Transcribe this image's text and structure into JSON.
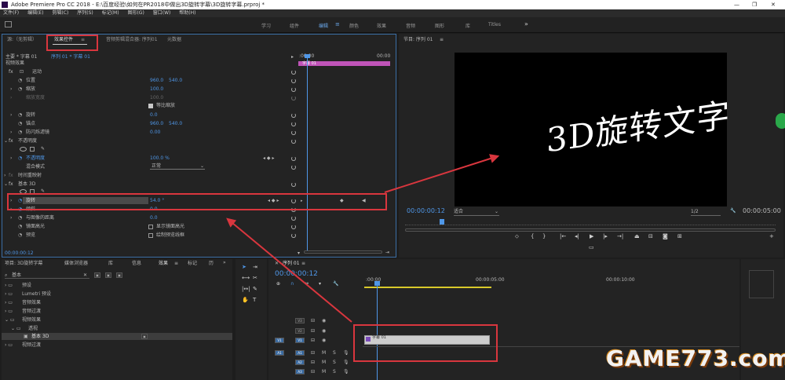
{
  "titlebar": {
    "title": "Adobe Premiere Pro CC 2018 - E:\\百度经验\\如何在PR2018中做出3D旋转字幕\\3D旋转字幕.prproj *"
  },
  "menu": [
    "文件(F)",
    "编辑(E)",
    "剪辑(C)",
    "序列(S)",
    "标记(M)",
    "图形(G)",
    "窗口(W)",
    "帮助(H)"
  ],
  "workspaces": [
    "学习",
    "组件",
    "编辑",
    "颜色",
    "效果",
    "音频",
    "图形",
    "库",
    "Titles"
  ],
  "effect_controls": {
    "tabs": [
      "源:（无剪辑）",
      "效果控件",
      "音频剪辑混合器: 序列01",
      "元数据"
    ],
    "header_master": "主要 * 字幕 01",
    "header_seq": "序列 01 * 字幕 01",
    "ruler_start": ":00:00",
    "ruler_end": "00:00",
    "clip_label": "字幕 01",
    "video_effects": "视频效果",
    "motion": "运动",
    "position": "位置",
    "position_x": "960.0",
    "position_y": "540.0",
    "scale": "缩放",
    "scale_val": "100.0",
    "scale_width": "缩放宽度",
    "scale_width_val": "100.0",
    "uniform_scale": "等比缩放",
    "rotation": "旋转",
    "rotation_val": "0.0",
    "anchor": "锚点",
    "anchor_x": "960.0",
    "anchor_y": "540.0",
    "antiflicker": "防闪烁滤镜",
    "antiflicker_val": "0.00",
    "opacity_group": "不透明度",
    "opacity": "不透明度",
    "opacity_val": "100.0 %",
    "blend": "混合模式",
    "blend_val": "正常",
    "time_remap": "时间重映射",
    "basic3d": "基本 3D",
    "swivel": "旋转",
    "swivel_val": "54.0 °",
    "tilt": "倾斜",
    "tilt_val": "0.0",
    "distance": "与图像的距离",
    "distance_val": "0.0",
    "specular": "镜面高光",
    "specular_opt": "显示镜面高光",
    "preview": "预览",
    "preview_opt": "绘制预览线框",
    "timecode": "00:00:00:12"
  },
  "program": {
    "title": "节目: 序列 01",
    "overlay_text": "3D旋转文字",
    "timecode": "00:00:00:12",
    "fit": "适合",
    "quality": "1/2",
    "duration": "00:00:05:00"
  },
  "project": {
    "tabs": [
      "项目: 3D旋转字幕",
      "媒体浏览器",
      "库",
      "信息",
      "效果",
      "标记",
      "历"
    ],
    "search": "基本",
    "tree": [
      "预设",
      "Lumetri 预设",
      "音频效果",
      "音频过渡",
      "视频效果",
      "透视",
      "基本 3D",
      "视频过渡"
    ]
  },
  "timeline": {
    "tab": "序列 01",
    "timecode": "00:00:00:12",
    "ruler": [
      ":00:00",
      "00:00:05:00",
      "00:00:10:00"
    ],
    "video_tracks": [
      "V3",
      "V2",
      "V1"
    ],
    "audio_tracks": [
      "A1",
      "A2",
      "A3"
    ],
    "clip_label": "字幕 01",
    "source_v": "V1",
    "source_a": "A1"
  },
  "watermark": {
    "text": "GAME773.com"
  }
}
